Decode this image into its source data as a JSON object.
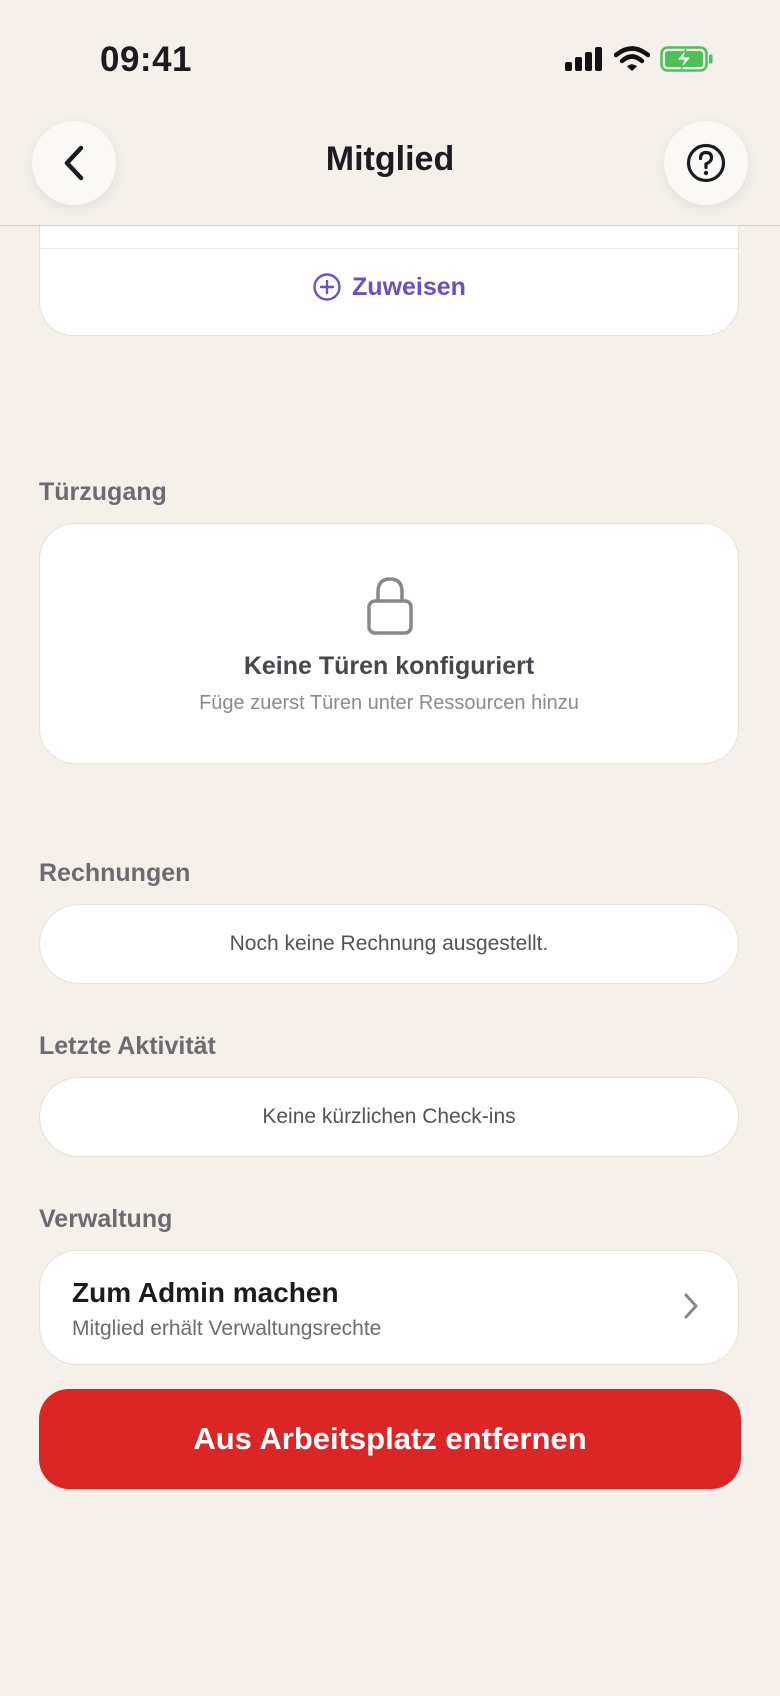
{
  "status_bar": {
    "time": "09:41"
  },
  "nav": {
    "title": "Mitglied"
  },
  "assign": {
    "label": "Zuweisen"
  },
  "door_access": {
    "heading": "Türzugang",
    "empty_title": "Keine Türen konfiguriert",
    "empty_subtitle": "Füge zuerst Türen unter Ressourcen hinzu"
  },
  "invoices": {
    "heading": "Rechnungen",
    "empty_text": "Noch keine Rechnung ausgestellt."
  },
  "activity": {
    "heading": "Letzte Aktivität",
    "empty_text": "Keine kürzlichen Check-ins"
  },
  "management": {
    "heading": "Verwaltung",
    "admin_title": "Zum Admin machen",
    "admin_subtitle": "Mitglied erhält Verwaltungsrechte"
  },
  "danger": {
    "remove_label": "Aus Arbeitsplatz entfernen"
  },
  "colors": {
    "background": "#f5f1ea",
    "accent": "#6b4fc8",
    "danger": "#dc2626",
    "battery": "#4cc15a"
  }
}
